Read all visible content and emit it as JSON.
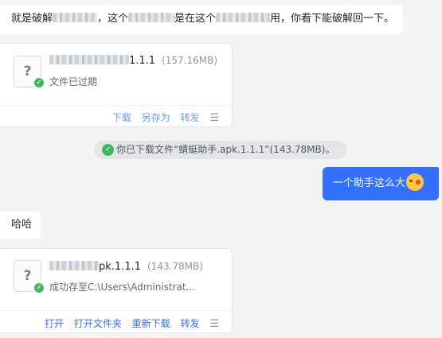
{
  "messages": {
    "msg1": {
      "part1": "就是破解",
      "part2": "，这个",
      "part3": "是在这个",
      "part4": "用，你看下能破解回一下。"
    },
    "file1": {
      "version": "1.1.1",
      "size": "(157.16MB)",
      "status": "文件已过期",
      "actions": [
        "下载",
        "另存为",
        "转发"
      ]
    },
    "system": {
      "text": "你已下载文件“蜻蜓助手.apk.1.1.1”(143.78MB)。"
    },
    "me": {
      "text": "一个助手这么大"
    },
    "msg2": {
      "text": "哈哈"
    },
    "file2": {
      "name_suffix": "pk.1.1.1",
      "size": "(143.78MB)",
      "status": "成功存至C:\\Users\\Administrat...",
      "actions": [
        "打开",
        "打开文件夹",
        "重新下载",
        "转发"
      ]
    }
  },
  "icons": {
    "file": "unknown-file-icon",
    "status": "check-circle-icon",
    "menu": "more-menu-icon",
    "emoji": "laughing-emoji-icon"
  },
  "colors": {
    "accent": "#3370ff",
    "success": "#3fb85f",
    "background": "#f2f3f5"
  }
}
